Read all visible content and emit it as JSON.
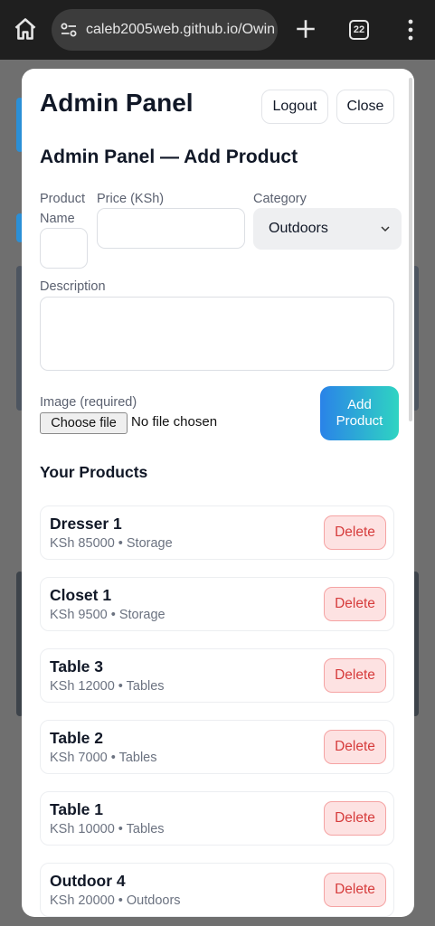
{
  "browser": {
    "url": "caleb2005web.github.io/Owin",
    "tab_count": "22"
  },
  "modal": {
    "title": "Admin Panel",
    "logout_label": "Logout",
    "close_label": "Close",
    "form": {
      "title": "Admin Panel — Add Product",
      "product_name_label_line1": "Product",
      "product_name_label_line2": "Name",
      "product_name_value": "",
      "price_label": "Price (KSh)",
      "price_value": "",
      "category_label": "Category",
      "category_selected": "Outdoors",
      "description_label": "Description",
      "description_value": "",
      "image_label": "Image (required)",
      "choose_file_label": "Choose file",
      "no_file_text": "No file chosen",
      "add_label_line1": "Add",
      "add_label_line2": "Product"
    },
    "products_title": "Your Products",
    "delete_label": "Delete",
    "products": [
      {
        "name": "Dresser 1",
        "meta": "KSh 85000 • Storage"
      },
      {
        "name": "Closet 1",
        "meta": "KSh 9500 • Storage"
      },
      {
        "name": "Table 3",
        "meta": "KSh 12000 • Tables"
      },
      {
        "name": "Table 2",
        "meta": "KSh 7000 • Tables"
      },
      {
        "name": "Table 1",
        "meta": "KSh 10000 • Tables"
      },
      {
        "name": "Outdoor 4",
        "meta": "KSh 20000 • Outdoors"
      }
    ]
  }
}
